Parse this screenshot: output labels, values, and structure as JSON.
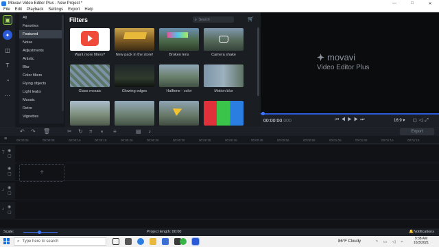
{
  "window": {
    "title": "Movavi Video Editor Plus - New Project *",
    "min": "—",
    "max": "□",
    "close": "✕"
  },
  "menu": [
    "File",
    "Edit",
    "Playback",
    "Settings",
    "Export",
    "Help"
  ],
  "sidebar": {
    "icons": [
      "import-icon",
      "effects-icon",
      "transitions-icon",
      "titles-icon",
      "stickers-icon",
      "more-icon"
    ]
  },
  "categories": {
    "items": [
      "All",
      "Favorites",
      "Featured",
      "Noise",
      "Adjustments",
      "Artistic",
      "Blur",
      "Color filters",
      "Flying objects",
      "Light leaks",
      "Mosaic",
      "Retro",
      "Vignettes"
    ],
    "selected": "Featured"
  },
  "filters": {
    "title": "Filters",
    "search_placeholder": "Search",
    "tiles": [
      {
        "label": "Want more filters?",
        "kind": "promo"
      },
      {
        "label": "New pack in the store!",
        "kind": "pack"
      },
      {
        "label": "Broken lens",
        "kind": "castle"
      },
      {
        "label": "Camera shake",
        "kind": "castle"
      },
      {
        "label": "Glass mosaic",
        "kind": "castle"
      },
      {
        "label": "Glowing edges",
        "kind": "castle"
      },
      {
        "label": "Halftone - color",
        "kind": "castle"
      },
      {
        "label": "Motion blur",
        "kind": "castle"
      },
      {
        "label": "",
        "kind": "castle"
      },
      {
        "label": "",
        "kind": "castle"
      },
      {
        "label": "",
        "kind": "castle"
      },
      {
        "label": "",
        "kind": "color"
      }
    ]
  },
  "preview": {
    "brand": "movavi",
    "product": "Video Editor Plus",
    "timecode": "00:00:00",
    "timecode_ms": ".000",
    "ratio": "16:9 ▾"
  },
  "toolbar": {
    "export": "Export"
  },
  "ruler": [
    "00:00:00",
    "00:00:05",
    "00:00:10",
    "00:00:15",
    "00:00:20",
    "00:00:25",
    "00:00:30",
    "00:00:35",
    "00:00:40",
    "00:00:45",
    "00:00:50",
    "00:00:55",
    "00:01:00",
    "00:01:05",
    "00:01:10",
    "00:01:15"
  ],
  "timeline": {
    "placeholder": "+"
  },
  "status": {
    "scale": "Scale:",
    "project_length": "Project length:  00:00",
    "notifications": "Notifications"
  },
  "taskbar": {
    "search": "Type here to search",
    "weather": "86°F  Cloudy",
    "time": "9:38 AM",
    "date": "10/3/2021"
  }
}
